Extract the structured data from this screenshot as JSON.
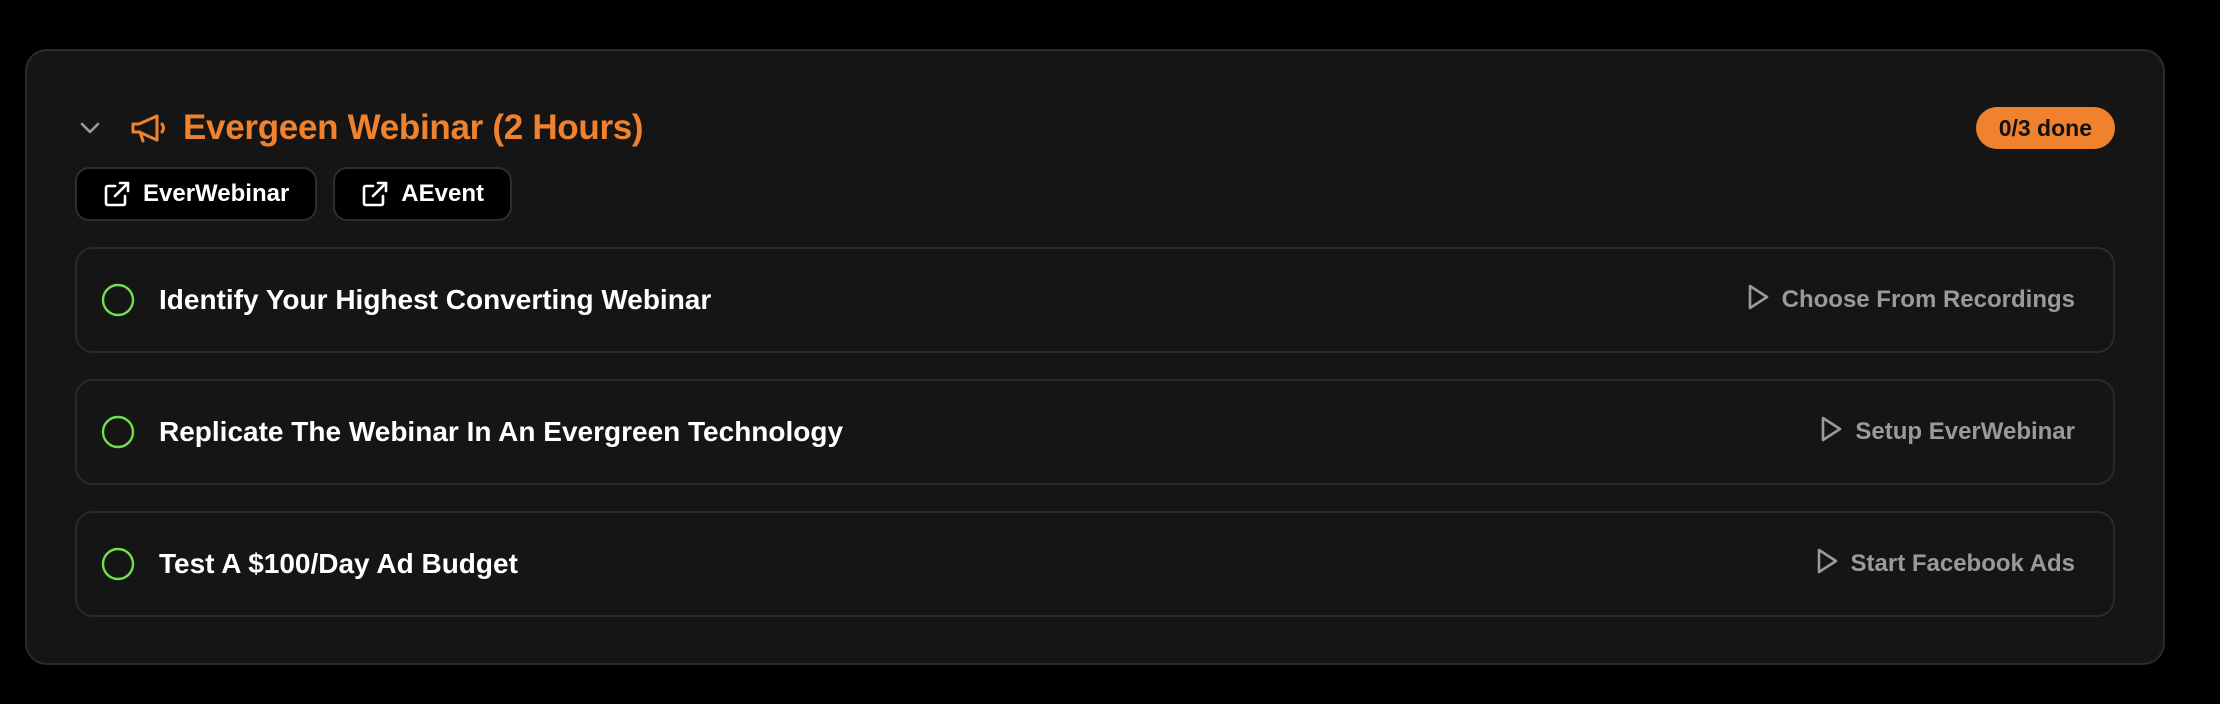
{
  "section": {
    "title": "Evergeen Webinar (2 Hours)",
    "badge": "0/3 done",
    "accent_color": "#f0822d",
    "icon": "megaphone-icon"
  },
  "links": [
    {
      "label": "EverWebinar",
      "icon": "external-link-icon"
    },
    {
      "label": "AEvent",
      "icon": "external-link-icon"
    }
  ],
  "tasks": [
    {
      "label": "Identify Your Highest Converting Webinar",
      "action": "Choose From Recordings",
      "done": false
    },
    {
      "label": "Replicate The Webinar In An Evergreen Technology",
      "action": "Setup EverWebinar",
      "done": false
    },
    {
      "label": "Test A $100/Day Ad Budget",
      "action": "Start Facebook Ads",
      "done": false
    }
  ],
  "colors": {
    "check_circle": "#6ee04a",
    "action_text": "#9a9a9a",
    "card_background": "#151515"
  }
}
